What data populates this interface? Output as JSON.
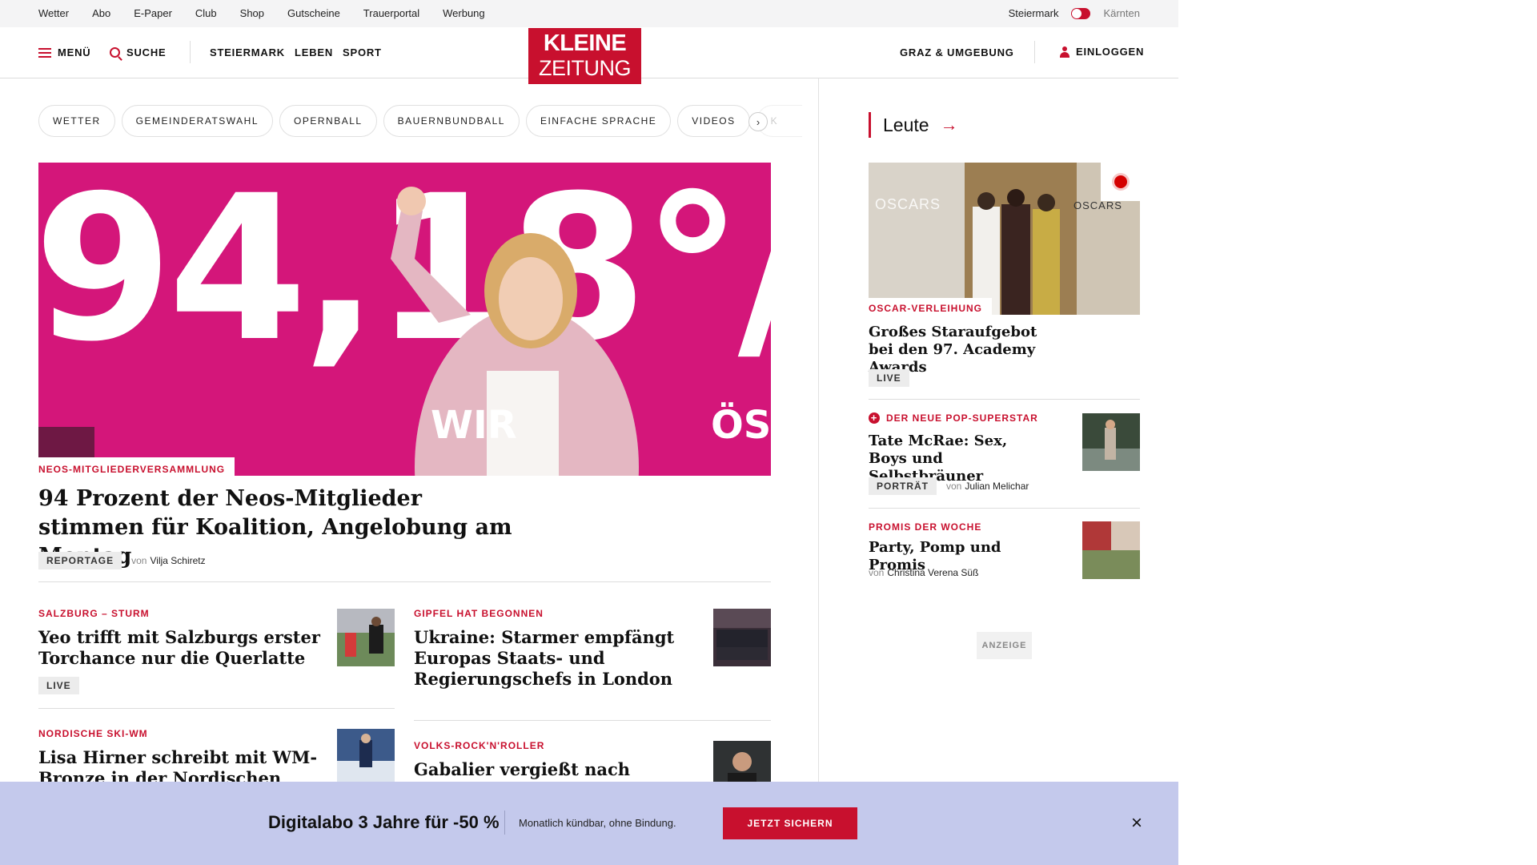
{
  "topbar": {
    "links": [
      "Wetter",
      "Abo",
      "E-Paper",
      "Club",
      "Shop",
      "Gutscheine",
      "Trauerportal",
      "Werbung"
    ],
    "region_active": "Steiermark",
    "region_inactive": "Kärnten"
  },
  "header": {
    "menu": "MENÜ",
    "search": "SUCHE",
    "nav": [
      "STEIERMARK",
      "LEBEN",
      "SPORT"
    ],
    "logo_line1": "KLEINE",
    "logo_line2": "ZEITUNG",
    "local": "GRAZ & UMGEBUNG",
    "login": "EINLOGGEN"
  },
  "chips": [
    "WETTER",
    "GEMEINDERATSWAHL",
    "OPERNBALL",
    "BAUERNBUNDBALL",
    "EINFACHE SPRACHE",
    "VIDEOS",
    "K"
  ],
  "hero": {
    "image_text_big": "94,18°/",
    "image_text_wir": "WIR",
    "image_text_ost": "ÖSTV",
    "kicker": "NEOS-MITGLIEDERVERSAMMLUNG",
    "title": "94 Prozent der Neos-Mitglieder stimmen für Koalition, Angelobung am Montag",
    "badge": "REPORTAGE",
    "by": "von",
    "author": "Vilja Schiretz"
  },
  "teasers": [
    {
      "kicker": "SALZBURG – STURM",
      "title": "Yeo trifft mit Salzburgs erster Torchance nur die Querlatte",
      "badge": "LIVE"
    },
    {
      "kicker": "GIPFEL HAT BEGONNEN",
      "title": "Ukraine: Starmer empfängt Europas Staats- und Regierungschefs in London"
    },
    {
      "kicker": "NORDISCHE SKI-WM",
      "title": "Lisa Hirner schreibt mit WM-Bronze in der Nordischen Kombination"
    },
    {
      "kicker": "VOLKS-ROCK'N'ROLLER",
      "title": "Gabalier vergießt nach"
    }
  ],
  "sidebar": {
    "section": "Leute",
    "img_text_1": "OSCARS",
    "img_text_2": "OSCARS",
    "items": [
      {
        "kicker": "OSCAR-VERLEIHUNG",
        "title": "Großes Staraufgebot bei den 97. Academy Awards",
        "badge": "LIVE"
      },
      {
        "kicker": "DER NEUE POP-SUPERSTAR",
        "title": "Tate McRae: Sex, Boys und Selbstbräuner",
        "badge": "PORTRÄT",
        "by": "von",
        "author": "Julian Melichar"
      },
      {
        "kicker": "PROMIS DER WOCHE",
        "title": "Party, Pomp und Promis",
        "by": "von",
        "author": "Christina Verena Süß"
      }
    ],
    "ad_label": "ANZEIGE"
  },
  "banner": {
    "title": "Digitalabo 3 Jahre für -50 %",
    "text": "Monatlich kündbar, ohne Bindung.",
    "button": "JETZT SICHERN"
  },
  "colors": {
    "brand_red": "#c8102e",
    "hero_pink": "#d4167a",
    "banner_bg": "#c4c9ec"
  }
}
